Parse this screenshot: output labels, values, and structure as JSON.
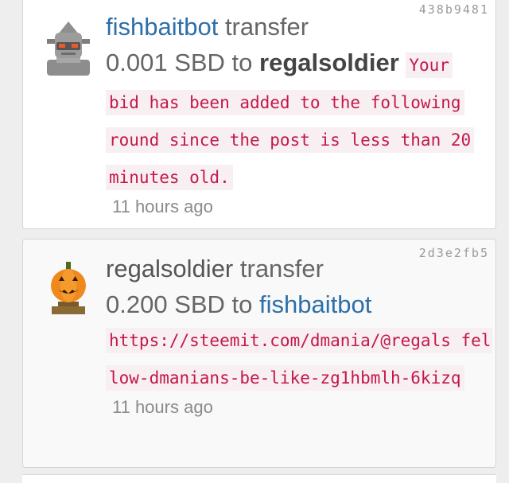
{
  "transfers": [
    {
      "id_hash": "438b9481",
      "from_user": "fishbaitbot",
      "action": " transfer",
      "amount": "0.001 SBD to ",
      "to_user": "regalsoldier",
      "memo": "Your bid has been added to the following round since the post is less than 20 minutes old.",
      "time": "11 hours ago",
      "avatar_icon": "robot-avatar-icon"
    },
    {
      "id_hash": "2d3e2fb5",
      "from_user": "regalsoldier",
      "action": " transfer",
      "amount": "0.200 SBD to ",
      "to_user": "fishbaitbot",
      "memo": "https://steemit.com/dmania/@regals fellow-dmanians-be-like-zg1hbmlh-6kizq",
      "time": "11 hours ago",
      "avatar_icon": "pumpkin-avatar-icon"
    }
  ],
  "colors": {
    "link_blue": "#2d6fa8",
    "memo_red": "#c4174a",
    "memo_bg": "#f7eff1",
    "muted_text": "#666666"
  }
}
